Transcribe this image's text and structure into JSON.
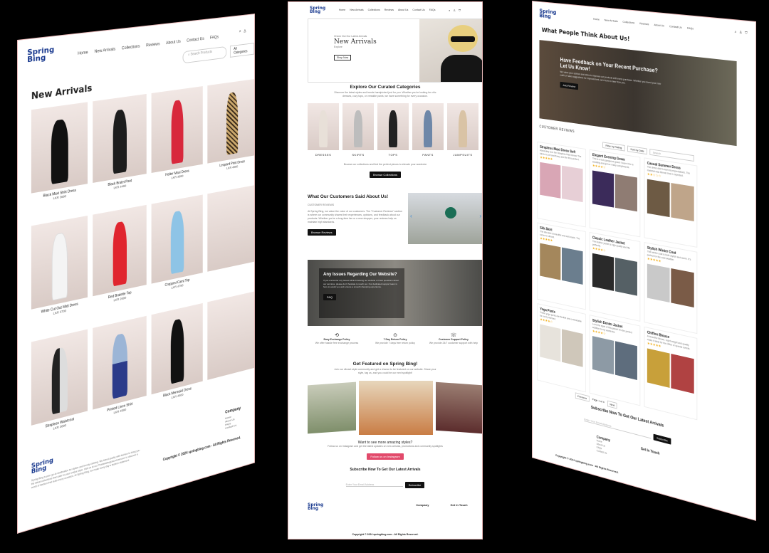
{
  "brand": {
    "logo_line1": "Spring",
    "logo_line2": "Bing",
    "accent": "#e24a6b",
    "logo_color": "#1a3a8f"
  },
  "left": {
    "nav": [
      "Home",
      "New Arrivals",
      "Collections",
      "Reviews",
      "About Us",
      "Contact Us",
      "FAQs"
    ],
    "search_placeholder": "Search Products",
    "category_select": "All Categories",
    "page_title": "New Arrivals",
    "products": [
      {
        "name": "Black Maxi Shirt Dress",
        "price": "LKR 3690"
      },
      {
        "name": "Black Bralet Pant",
        "price": "LKR 4490"
      },
      {
        "name": "Halter Maxi Dress",
        "price": "LKR 4890"
      },
      {
        "name": "Leopard Print Dress",
        "price": "LKR 4990"
      },
      {
        "name": "White Cut Out Midi Dress",
        "price": "LKR 3700"
      },
      {
        "name": "Red Bralette Top",
        "price": "LKR 2690"
      },
      {
        "name": "Cropped Cami Top",
        "price": "LKR 4790"
      },
      {
        "name": "",
        "price": ""
      },
      {
        "name": "Strapless Waistcoat",
        "price": "LKR 3690"
      },
      {
        "name": "Printed Linen Shirt",
        "price": "LKR 4590"
      },
      {
        "name": "Black Mermaid Dress",
        "price": "LKR 4500"
      },
      {
        "name": "",
        "price": ""
      }
    ],
    "footer_company_heading": "Company",
    "footer_links": [
      "Home",
      "About Us",
      "FAQs",
      "Contact Us"
    ],
    "footer_about": "Spring Bing is your go-to destination for stylish and trendy clothing. We blend quality with fashion to bring you the latest collections that cater to your unique style. Visit us at our Thalawathugoda showroom to discover a world of fashion that suits every occasion. At Spring Bing, we make every day a fashion statement.",
    "copyright": "Copyright © 2024 springbing.com - All Rights Reserved."
  },
  "mid": {
    "nav": [
      "Home",
      "New Arrivals",
      "Collections",
      "Reviews",
      "About Us",
      "Contact Us",
      "FAQs"
    ],
    "hero_kicker": "Check Out Our Latest Arrivals",
    "hero_title": "New Arrivals",
    "hero_sub": "Explore",
    "hero_button": "Shop Now",
    "categories_title": "Explore Our Curated Categories",
    "categories_sub": "Discover the latest styles and trends handpicked just for you. Whether you're looking for chic dresses, cozy tops, or versatile pants, we have something for every occasion.",
    "categories": [
      "DRESSES",
      "SKIRTS",
      "TOPS",
      "PANTS",
      "JUMPSUITS"
    ],
    "categories_cta_text": "Browse our collections and find the perfect pieces to elevate your wardrobe",
    "categories_button": "Browse Collections",
    "customers_title": "What Our Customers Said About Us!",
    "customers_kicker": "CUSTOMER REVIEWS",
    "customers_body": "At Spring Bing, we value the voice of our customers. The \"Customer Reviews\" section is where our community shares their experiences, opinions, and feedback about our products. Whether you're a long-time fan or a new shopper, your reviews help us maintain high standards.",
    "customers_button": "Browse Reviews",
    "issues_title": "Any Issues Regarding Our Website?",
    "issues_body": "If you encounter any issues while browsing our website or have questions about our services, please don't hesitate to reach out. Our dedicated support team is here to assist you and ensure a smooth shopping experience.",
    "issues_button": "FAQ",
    "policies": [
      {
        "title": "Easy Exchange Policy",
        "sub": "We offer hassle free exchange process"
      },
      {
        "title": "7 Day Return Policy",
        "sub": "We provide 7 days free return policy"
      },
      {
        "title": "Customer Support Policy",
        "sub": "We provide 24/7 customer support with help"
      }
    ],
    "featured_title": "Get Featured on Spring Bing!",
    "featured_sub": "Join our vibrant style community and get a chance to be featured on our website. Share your style, tag us, and you could be our next spotlight!",
    "featured_question": "Want to see more amazing styles?",
    "featured_text": "Follow us on Instagram and get the latest updates on new arrivals, promotions and community spotlights",
    "featured_button": "Follow us on Instagram",
    "subscribe_title": "Subscribe Now To Get Our Latest Arrivals",
    "subscribe_placeholder": "Enter Your Email Address",
    "subscribe_button": "Subscribe",
    "footer_company": "Company",
    "footer_touch": "Get In Touch",
    "copyright": "Copyright © 2024 springbing.com - All Rights Reserved."
  },
  "right": {
    "nav": [
      "Home",
      "New Arrivals",
      "Collections",
      "Reviews",
      "About Us",
      "Contact Us",
      "FAQs"
    ],
    "page_title": "What People Think About Us!",
    "hero_title": "Have Feedback on Your Recent Purchase? Let Us Know!",
    "hero_body": "We value your opinion and strive to improve our products with every purchase. Whether you loved your new outfit or have suggestions for improvement, we'd love to hear from you.",
    "hero_button": "Add Review",
    "section_label": "CUSTOMER REVIEWS",
    "filter_label": "Filter by Rating",
    "sort_label": "Sort by Date",
    "search_placeholder": "Search",
    "reviews": [
      {
        "title": "Strapless Maxi Dress Soft",
        "text": "Absolutely love the Strapless Maxi Dress! The fabric is soft and flowy, and the fit is perfect.",
        "stars": 5
      },
      {
        "title": "Elegant Evening Gown",
        "text": "This is a truly gorgeous gown! I wore it for a wedding and got so many compliments.",
        "stars": 4
      },
      {
        "title": "Casual Summer Dress",
        "text": "The dress didn't meet my expectations. The material was thinner than I expected.",
        "stars": 2
      },
      {
        "title": "Silk Skirt",
        "text": "The silk skirt is beautiful and well-made. The colour is vibrant.",
        "stars": 5
      },
      {
        "title": "Classic Leather Jacket",
        "text": "The leather jacket is high quality and fits perfectly.",
        "stars": 4
      },
      {
        "title": "Stylish Winter Coat",
        "text": "This winter coat is both stylish and warm. It's perfect for the cold weather.",
        "stars": 5
      },
      {
        "title": "Yoga Pants",
        "text": "These yoga pants are flexible and comfortable for every workout.",
        "stars": 4
      },
      {
        "title": "Stylish Denim Jacket",
        "text": "Love the style of this jacket! It's the perfect addition to my wardrobe.",
        "stars": 4
      },
      {
        "title": "Chiffon Blouse",
        "text": "A beautiful blouse. Light weight and quality make it ideal for the office or special events.",
        "stars": 5
      }
    ],
    "pagination": [
      "Previous",
      "Page 1 of 4",
      "Next"
    ],
    "subscribe_title": "Subscribe Now To Get Our Latest Arrivals",
    "subscribe_placeholder": "Enter Your Email Address",
    "subscribe_button": "Subscribe",
    "footer_company": "Company",
    "footer_links": [
      "Home",
      "About Us",
      "FAQs",
      "Contact Us"
    ],
    "footer_touch": "Get In Touch",
    "copyright": "Copyright © 2024 springbing.com - All Rights Reserved."
  }
}
